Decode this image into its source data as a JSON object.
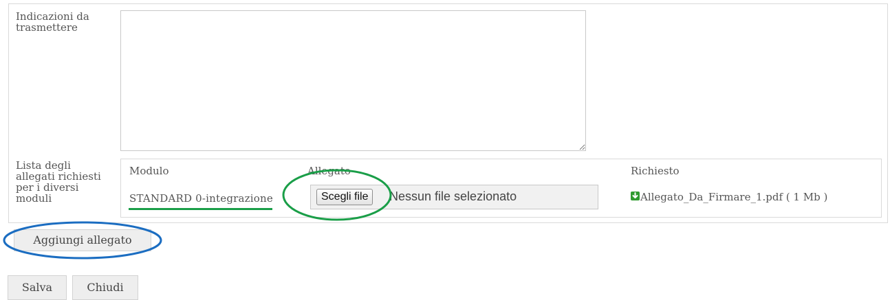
{
  "form": {
    "notes_label": "Indicazioni da trasmettere",
    "notes_value": "",
    "attachments_label": "Lista degli allegati richiesti per i diversi moduli"
  },
  "attachments_table": {
    "headers": [
      "Modulo",
      "Allegato",
      "Richiesto"
    ],
    "rows": [
      {
        "module": "STANDARD 0-integrazione",
        "file_button_label": "Scegli file",
        "file_status": "Nessun file selezionato",
        "required_file": "Allegato_Da_Firmare_1.pdf ( 1 Mb )",
        "required_icon": "download-icon"
      }
    ]
  },
  "buttons": {
    "add_attachment": "Aggiungi allegato",
    "save": "Salva",
    "close": "Chiudi"
  },
  "annotations": {
    "blue_circle_color": "#1b6dc1",
    "green_circle_color": "#1a9e48"
  }
}
